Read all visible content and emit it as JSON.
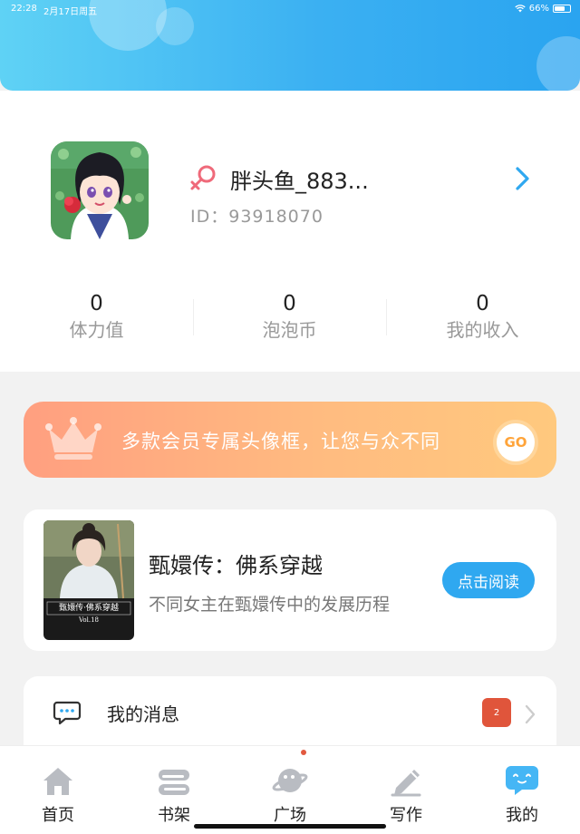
{
  "status_bar": {
    "time": "22:28",
    "date": "2月17日周五",
    "battery": "66%",
    "battery_level": 0.66
  },
  "profile": {
    "username": "胖头鱼_883...",
    "id_text": "ID：93918070"
  },
  "stats": [
    {
      "value": "0",
      "label": "体力值"
    },
    {
      "value": "0",
      "label": "泡泡币"
    },
    {
      "value": "0",
      "label": "我的收入"
    }
  ],
  "vip_banner": {
    "text": "多款会员专属头像框，让您与众不同",
    "go_label": "GO"
  },
  "book": {
    "title": "甄嬛传：佛系穿越",
    "description": "不同女主在甄嬛传中的发展历程",
    "read_label": "点击阅读",
    "cover_title": "甄嬛传·佛系穿越",
    "cover_vol": "Vol.18"
  },
  "menu": {
    "messages_label": "我的消息",
    "messages_badge": "2"
  },
  "tabs": [
    {
      "label": "首页",
      "icon": "home-icon"
    },
    {
      "label": "书架",
      "icon": "bookshelf-icon"
    },
    {
      "label": "广场",
      "icon": "planet-icon"
    },
    {
      "label": "写作",
      "icon": "pen-icon"
    },
    {
      "label": "我的",
      "icon": "chat-face-icon"
    }
  ],
  "colors": {
    "header_gradient": [
      "#5fd2f5",
      "#2aa4f0"
    ],
    "accent_blue": "#2fa8f0",
    "vip_gradient": [
      "#ff9f80",
      "#ffc97e"
    ],
    "badge_red": "#e0553b",
    "gender_pink": "#ef6a7a"
  }
}
